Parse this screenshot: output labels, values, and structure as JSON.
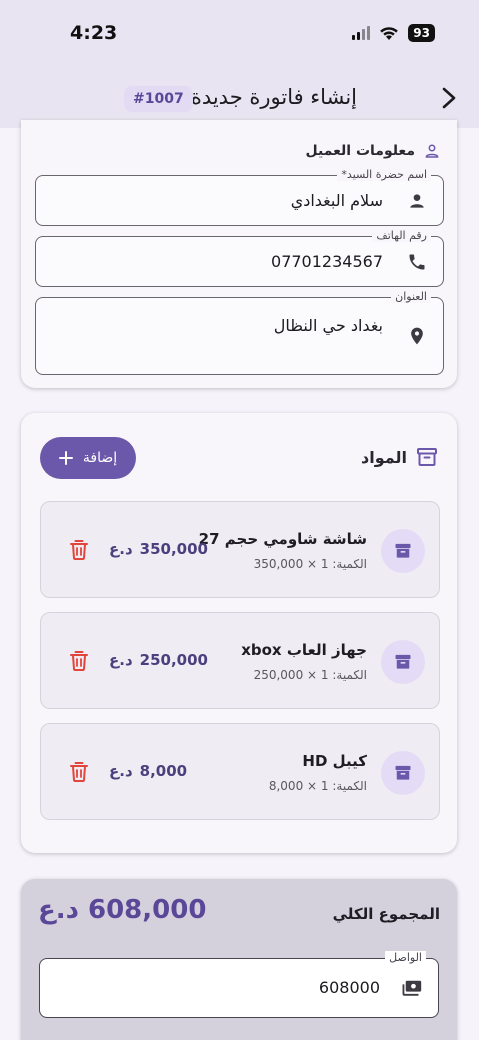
{
  "status_bar": {
    "time": "4:23",
    "battery": "93"
  },
  "header": {
    "title": "إنشاء فاتورة جديدة",
    "invoice_number": "#1007"
  },
  "customer": {
    "section_title": "معلومات العميل",
    "name": {
      "label": "اسم حضرة السيد*",
      "value": "سلام البغدادي"
    },
    "phone": {
      "label": "رقم الهاتف",
      "value": "07701234567"
    },
    "address": {
      "label": "العنوان",
      "value": "بغداد حي النظال"
    }
  },
  "items": {
    "section_title": "المواد",
    "add_label": "إضافة",
    "list": [
      {
        "name": "شاشة شاومي حجم 27",
        "qty": "الكمية: 1 × 350,000",
        "price": "350,000",
        "currency": "د.ع"
      },
      {
        "name": "جهاز العاب xbox",
        "qty": "الكمية: 1 × 250,000",
        "price": "250,000",
        "currency": "د.ع"
      },
      {
        "name": "كيبل HD",
        "qty": "الكمية: 1 × 8,000",
        "price": "8,000",
        "currency": "د.ع"
      }
    ]
  },
  "total": {
    "label": "المجموع الكلي",
    "value": "608,000",
    "currency": "د.ع",
    "paid_label": "الواصل",
    "paid_value": "608000"
  },
  "colors": {
    "accent": "#6b58aa",
    "delete": "#e2453b",
    "appbar": "#e9e4f1"
  }
}
